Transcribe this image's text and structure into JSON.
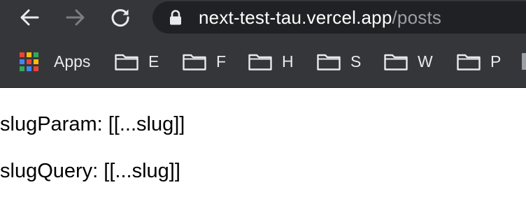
{
  "browser": {
    "url_host": "next-test-tau.vercel.app",
    "url_path": "/posts",
    "icons": {
      "back": "arrow-left-icon",
      "forward": "arrow-right-icon",
      "reload": "reload-icon",
      "lock": "lock-icon"
    }
  },
  "bookmarks": {
    "apps_label": "Apps",
    "folders": [
      "E",
      "F",
      "H",
      "S",
      "W",
      "P"
    ],
    "apps_grid_colors": [
      "#ea4335",
      "#fbbc04",
      "#34a853",
      "#4285f4",
      "#ea4335",
      "#fbbc04",
      "#34a853",
      "#4285f4",
      "#ea4335"
    ]
  },
  "page": {
    "slug_param_label": "slugParam: [[...slug]]",
    "slug_query_label": "slugQuery: [[...slug]]"
  },
  "colors": {
    "chrome_bg": "#35363a",
    "omnibox_bg": "#202124",
    "text_light": "#e8eaed",
    "text_dim": "#9aa0a6"
  }
}
